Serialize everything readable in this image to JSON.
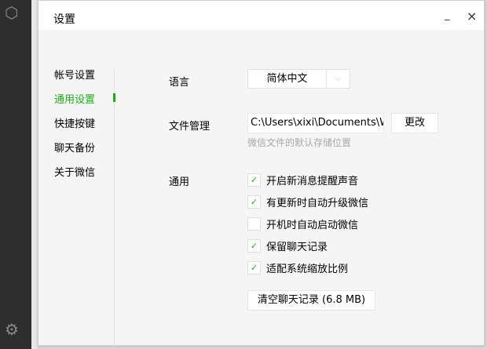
{
  "window": {
    "title": "设置",
    "minimize": "_",
    "close": "×"
  },
  "nav": {
    "items": [
      {
        "label": "帐号设置"
      },
      {
        "label": "通用设置",
        "active": true
      },
      {
        "label": "快捷按键"
      },
      {
        "label": "聊天备份"
      },
      {
        "label": "关于微信"
      }
    ]
  },
  "language": {
    "label": "语言",
    "value": "简体中文"
  },
  "files": {
    "label": "文件管理",
    "path": "C:\\Users\\xixi\\Documents\\WeChat Files",
    "change": "更改",
    "hint": "微信文件的默认存储位置"
  },
  "general": {
    "label": "通用",
    "options": [
      {
        "label": "开启新消息提醒声音",
        "checked": true
      },
      {
        "label": "有更新时自动升级微信",
        "checked": true
      },
      {
        "label": "开机时自动启动微信",
        "checked": false
      },
      {
        "label": "保留聊天记录",
        "checked": true
      },
      {
        "label": "适配系统缩放比例",
        "checked": true
      }
    ],
    "clear": "清空聊天记录 (6.8 MB)"
  },
  "colors": {
    "accent": "#1aad19"
  }
}
